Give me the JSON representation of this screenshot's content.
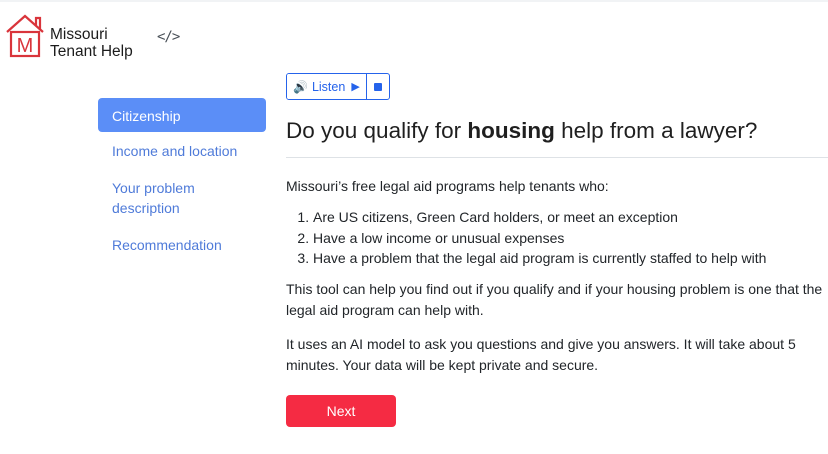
{
  "app": {
    "name_line1": "Missouri",
    "name_line2": "Tenant Help",
    "logo_letter": "M",
    "code_icon": "</>"
  },
  "listen": {
    "label": "Listen",
    "speaker_icon": "🔊",
    "play_icon": "▶"
  },
  "sidebar": {
    "items": [
      {
        "label": "Citizenship",
        "active": true
      },
      {
        "label": "Income and location",
        "active": false
      },
      {
        "label": "Your problem description",
        "active": false
      },
      {
        "label": "Recommendation",
        "active": false
      }
    ]
  },
  "main": {
    "title_pre": "Do you qualify for ",
    "title_bold": "housing",
    "title_post": " help from a lawyer?",
    "intro": "Missouri’s free legal aid programs help tenants who:",
    "criteria": [
      "Are US citizens, Green Card holders, or meet an exception",
      "Have a low income or unusual expenses",
      "Have a problem that the legal aid program is currently staffed to help with"
    ],
    "para1": "This tool can help you find out if you qualify and if your housing problem is one that the legal aid program can help with.",
    "para2": "It uses an AI model to ask you questions and give you answers. It will take about 5 minutes. Your data will be kept private and secure.",
    "next_label": "Next"
  },
  "colors": {
    "accent_blue": "#2563eb",
    "sidebar_active": "#5b8ef7",
    "next_red": "#f52b43",
    "logo_red": "#d9343b"
  }
}
